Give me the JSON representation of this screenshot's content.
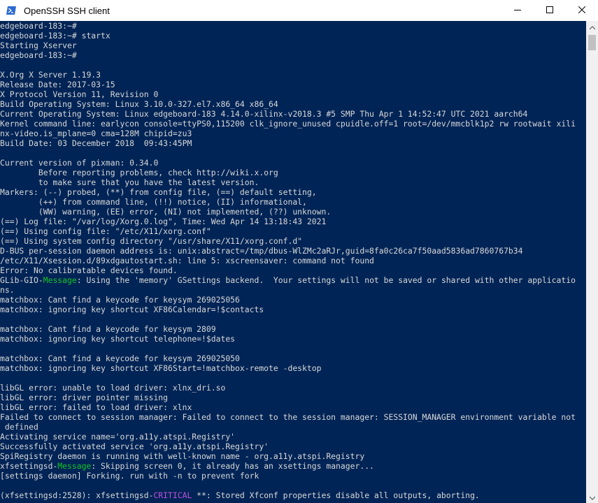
{
  "window": {
    "title": "OpenSSH SSH client",
    "background_color": "#012456",
    "minimize_icon": "minimize-icon",
    "maximize_icon": "maximize-icon",
    "close_icon": "close-icon",
    "app_icon": "powershell-icon"
  },
  "terminal": {
    "highlight_colors": {
      "green": "#13c427",
      "magenta": "#c050d8"
    },
    "lines": [
      [
        {
          "t": "edgeboard-183:~#"
        }
      ],
      [
        {
          "t": "edgeboard-183:~# startx"
        }
      ],
      [
        {
          "t": "Starting Xserver"
        }
      ],
      [
        {
          "t": "edgeboard-183:~#"
        }
      ],
      [
        {
          "t": ""
        }
      ],
      [
        {
          "t": "X.Org X Server 1.19.3"
        }
      ],
      [
        {
          "t": "Release Date: 2017-03-15"
        }
      ],
      [
        {
          "t": "X Protocol Version 11, Revision 0"
        }
      ],
      [
        {
          "t": "Build Operating System: Linux 3.10.0-327.el7.x86_64 x86_64"
        }
      ],
      [
        {
          "t": "Current Operating System: Linux edgeboard-183 4.14.0-xilinx-v2018.3 #5 SMP Thu Apr 1 14:52:47 UTC 2021 aarch64"
        }
      ],
      [
        {
          "t": "Kernel command line: earlycon console=ttyPS0,115200 clk_ignore_unused cpuidle.off=1 root=/dev/mmcblk1p2 rw rootwait xili"
        }
      ],
      [
        {
          "t": "nx-video.is_mplane=0 cma=128M chipid=zu3"
        }
      ],
      [
        {
          "t": "Build Date: 03 December 2018  09:43:45PM"
        }
      ],
      [
        {
          "t": ""
        }
      ],
      [
        {
          "t": "Current version of pixman: 0.34.0"
        }
      ],
      [
        {
          "t": "        Before reporting problems, check http://wiki.x.org"
        }
      ],
      [
        {
          "t": "        to make sure that you have the latest version."
        }
      ],
      [
        {
          "t": "Markers: (--) probed, (**) from config file, (==) default setting,"
        }
      ],
      [
        {
          "t": "        (++) from command line, (!!) notice, (II) informational,"
        }
      ],
      [
        {
          "t": "        (WW) warning, (EE) error, (NI) not implemented, (??) unknown."
        }
      ],
      [
        {
          "t": "(==) Log file: \"/var/log/Xorg.0.log\", Time: Wed Apr 14 13:18:43 2021"
        }
      ],
      [
        {
          "t": "(==) Using config file: \"/etc/X11/xorg.conf\""
        }
      ],
      [
        {
          "t": "(==) Using system config directory \"/usr/share/X11/xorg.conf.d\""
        }
      ],
      [
        {
          "t": "D-BUS per-session daemon address is: unix:abstract=/tmp/dbus-WlZMc2aRJr,guid=8fa0c26ca7f50aad5836ad7860767b34"
        }
      ],
      [
        {
          "t": "/etc/X11/Xsession.d/89xdgautostart.sh: line 5: xscreensaver: command not found"
        }
      ],
      [
        {
          "t": "Error: No calibratable devices found."
        }
      ],
      [
        {
          "t": "GLib-GIO-"
        },
        {
          "t": "Message",
          "c": "green"
        },
        {
          "t": ": Using the 'memory' GSettings backend.  Your settings will not be saved or shared with other applicatio"
        }
      ],
      [
        {
          "t": "ns."
        }
      ],
      [
        {
          "t": "matchbox: Cant find a keycode for keysym 269025056"
        }
      ],
      [
        {
          "t": "matchbox: ignoring key shortcut XF86Calendar=!$contacts"
        }
      ],
      [
        {
          "t": ""
        }
      ],
      [
        {
          "t": "matchbox: Cant find a keycode for keysym 2809"
        }
      ],
      [
        {
          "t": "matchbox: ignoring key shortcut telephone=!$dates"
        }
      ],
      [
        {
          "t": ""
        }
      ],
      [
        {
          "t": "matchbox: Cant find a keycode for keysym 269025050"
        }
      ],
      [
        {
          "t": "matchbox: ignoring key shortcut XF86Start=!matchbox-remote -desktop"
        }
      ],
      [
        {
          "t": ""
        }
      ],
      [
        {
          "t": "libGL error: unable to load driver: xlnx_dri.so"
        }
      ],
      [
        {
          "t": "libGL error: driver pointer missing"
        }
      ],
      [
        {
          "t": "libGL error: failed to load driver: xlnx"
        }
      ],
      [
        {
          "t": "Failed to connect to session manager: Failed to connect to the session manager: SESSION_MANAGER environment variable not"
        }
      ],
      [
        {
          "t": " defined"
        }
      ],
      [
        {
          "t": "Activating service name='org.a11y.atspi.Registry'"
        }
      ],
      [
        {
          "t": "Successfully activated service 'org.a11y.atspi.Registry'"
        }
      ],
      [
        {
          "t": "SpiRegistry daemon is running with well-known name - org.a11y.atspi.Registry"
        }
      ],
      [
        {
          "t": "xfsettingsd-"
        },
        {
          "t": "Message",
          "c": "green"
        },
        {
          "t": ": Skipping screen 0, it already has an xsettings manager..."
        }
      ],
      [
        {
          "t": "[settings daemon] Forking. run with -n to prevent fork"
        }
      ],
      [
        {
          "t": ""
        }
      ],
      [
        {
          "t": "(xfsettingsd:2528): xfsettingsd-"
        },
        {
          "t": "CRITICAL",
          "c": "magenta"
        },
        {
          "t": " **: Stored Xfconf properties disable all outputs, aborting."
        }
      ]
    ]
  }
}
